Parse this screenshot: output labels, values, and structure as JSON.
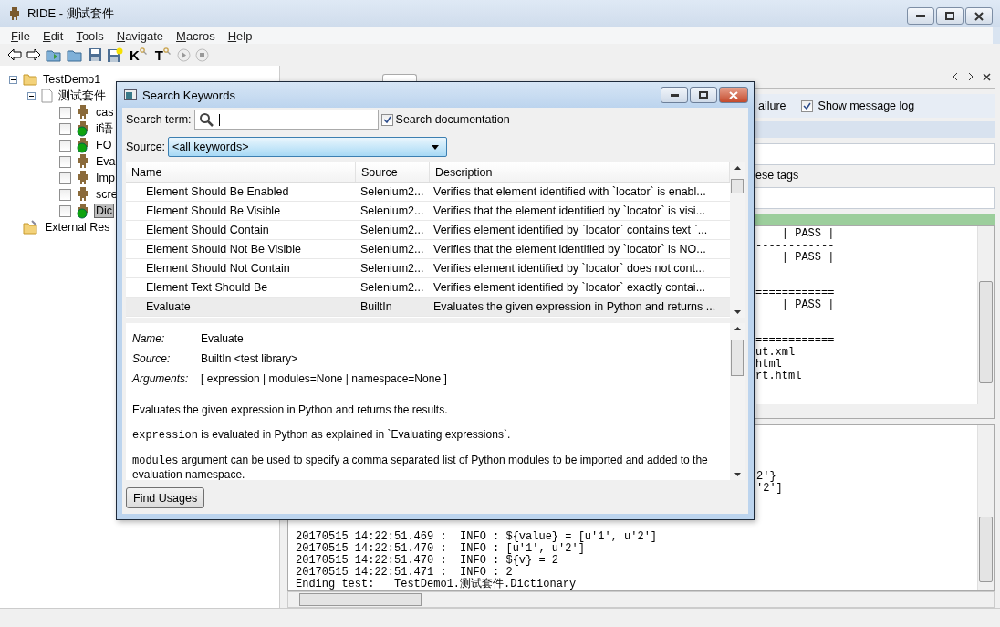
{
  "window": {
    "title": "RIDE - 测试套件"
  },
  "menu": [
    "File",
    "Edit",
    "Tools",
    "Navigate",
    "Macros",
    "Help"
  ],
  "toolbar": [
    {
      "kind": "back"
    },
    {
      "kind": "forward"
    },
    {
      "kind": "open-suite"
    },
    {
      "kind": "open-dir"
    },
    {
      "kind": "save"
    },
    {
      "kind": "save-all"
    },
    {
      "kind": "search",
      "label": "K"
    },
    {
      "kind": "search",
      "label": "T"
    },
    {
      "kind": "run"
    },
    {
      "kind": "stop"
    }
  ],
  "tree": [
    {
      "label": "TestDemo1",
      "kind": "folder",
      "expanded": true,
      "children": [
        {
          "label": "测试套件",
          "kind": "suite",
          "expanded": true,
          "children": [
            {
              "label": "cas",
              "kind": "test",
              "checked": false,
              "passed": false,
              "selected": false
            },
            {
              "label": "if语",
              "kind": "test",
              "checked": false,
              "passed": true,
              "selected": false
            },
            {
              "label": "FO",
              "kind": "test",
              "checked": false,
              "passed": true,
              "selected": false
            },
            {
              "label": "Eva",
              "kind": "test",
              "checked": false,
              "passed": false,
              "selected": false
            },
            {
              "label": "Imp",
              "kind": "test",
              "checked": false,
              "passed": false,
              "selected": false
            },
            {
              "label": "scre",
              "kind": "test",
              "checked": false,
              "passed": false,
              "selected": false
            },
            {
              "label": "Dic",
              "kind": "test",
              "checked": false,
              "passed": true,
              "selected": true
            }
          ]
        }
      ]
    },
    {
      "label": "External Res",
      "kind": "resources"
    }
  ],
  "run_panel": {
    "options": [
      {
        "label": "ailure"
      },
      {
        "label": "Show message log",
        "checked": true
      }
    ],
    "tags_label": "ese tags",
    "output_blocks": [
      [
        "    | PASS |",
        "------------",
        "    | PASS |"
      ],
      [
        "============",
        "    | PASS |"
      ],
      [
        "============",
        "ut.xml",
        "html",
        "rt.html"
      ]
    ],
    "log_fragments": [
      "2'}",
      "'2']"
    ],
    "log_lines": [
      "20170515 14:22:51.469 :  INFO : ${value} = [u'1', u'2']",
      "20170515 14:22:51.470 :  INFO : [u'1', u'2']",
      "20170515 14:22:51.470 :  INFO : ${v} = 2",
      "20170515 14:22:51.471 :  INFO : 2",
      "Ending test:   TestDemo1.测试套件.Dictionary"
    ]
  },
  "dialog": {
    "title": "Search Keywords",
    "search_label": "Search term:",
    "search_documentation": {
      "label": "Search documentation",
      "checked": true
    },
    "source_label": "Source:",
    "source_value": "<all keywords>",
    "columns": [
      "Name",
      "Source",
      "Description"
    ],
    "rows": [
      {
        "name": "Element Should Be Enabled",
        "source": "Selenium2...",
        "description": "Verifies that element identified with `locator` is enabl...",
        "selected": false
      },
      {
        "name": "Element Should Be Visible",
        "source": "Selenium2...",
        "description": "Verifies that the element identified by `locator` is visi...",
        "selected": false
      },
      {
        "name": "Element Should Contain",
        "source": "Selenium2...",
        "description": "Verifies element identified by `locator` contains text `...",
        "selected": false
      },
      {
        "name": "Element Should Not Be Visible",
        "source": "Selenium2...",
        "description": "Verifies that the element identified by `locator` is NO...",
        "selected": false
      },
      {
        "name": "Element Should Not Contain",
        "source": "Selenium2...",
        "description": "Verifies element identified by `locator` does not cont...",
        "selected": false
      },
      {
        "name": "Element Text Should Be",
        "source": "Selenium2...",
        "description": "Verifies element identified by `locator` exactly contai...",
        "selected": false
      },
      {
        "name": "Evaluate",
        "source": "BuiltIn",
        "description": "Evaluates the given expression in Python and returns ...",
        "selected": true
      }
    ],
    "doc_fields": [
      {
        "label": "Name:",
        "value": "Evaluate"
      },
      {
        "label": "Source:",
        "value": "BuiltIn <test library>"
      },
      {
        "label": "Arguments:",
        "value": "[ expression | modules=None | namespace=None ]"
      }
    ],
    "doc_paragraphs": [
      {
        "text": "Evaluates the given expression in Python and returns the results."
      },
      {
        "code": "expression",
        "text": " is evaluated in Python as explained in `Evaluating expressions`."
      },
      {
        "code": "modules",
        "text": " argument can be used to specify a comma separated list of Python modules to be imported and added to the evaluation namespace."
      }
    ],
    "button": "Find Usages"
  }
}
